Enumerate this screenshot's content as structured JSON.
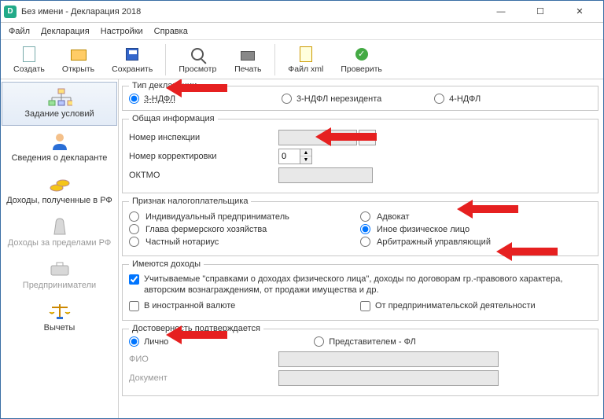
{
  "window": {
    "title": "Без имени - Декларация 2018"
  },
  "menu": {
    "file": "Файл",
    "decl": "Декларация",
    "settings": "Настройки",
    "help": "Справка"
  },
  "toolbar": {
    "create": "Создать",
    "open": "Открыть",
    "save": "Сохранить",
    "preview": "Просмотр",
    "print": "Печать",
    "xml": "Файл xml",
    "check": "Проверить"
  },
  "sidebar": {
    "conditions": "Задание условий",
    "declarant": "Сведения о декларанте",
    "income_rf": "Доходы, полученные в РФ",
    "income_abroad": "Доходы за пределами РФ",
    "entrepreneurs": "Предприниматели",
    "deductions": "Вычеты"
  },
  "decl_type": {
    "legend": "Тип декларации",
    "ndfl3": "3-НДФЛ",
    "ndfl3nr": "3-НДФЛ нерезидента",
    "ndfl4": "4-НДФЛ",
    "selected": "ndfl3"
  },
  "general": {
    "legend": "Общая информация",
    "inspection_label": "Номер инспекции",
    "correction_label": "Номер корректировки",
    "correction_value": "0",
    "oktmo_label": "ОКТМО"
  },
  "taxpayer": {
    "legend": "Признак налогоплательщика",
    "ind_entrepreneur": "Индивидуальный предприниматель",
    "farm_head": "Глава фермерского хозяйства",
    "private_notary": "Частный нотариус",
    "lawyer": "Адвокат",
    "other_person": "Иное физическое лицо",
    "arbitration": "Арбитражный управляющий",
    "selected": "other_person"
  },
  "incomes": {
    "legend": "Имеются доходы",
    "chk1": "Учитываемые \"справками о доходах физического лица\", доходы по договорам гр.-правового характера, авторским вознаграждениям, от продажи имущества и др.",
    "chk2": "В иностранной валюте",
    "chk3": "От предпринимательской деятельности"
  },
  "confirm": {
    "legend": "Достоверность подтверждается",
    "personally": "Лично",
    "repr": "Представителем - ФЛ",
    "fio_label": "ФИО",
    "doc_label": "Документ",
    "selected": "personally"
  }
}
